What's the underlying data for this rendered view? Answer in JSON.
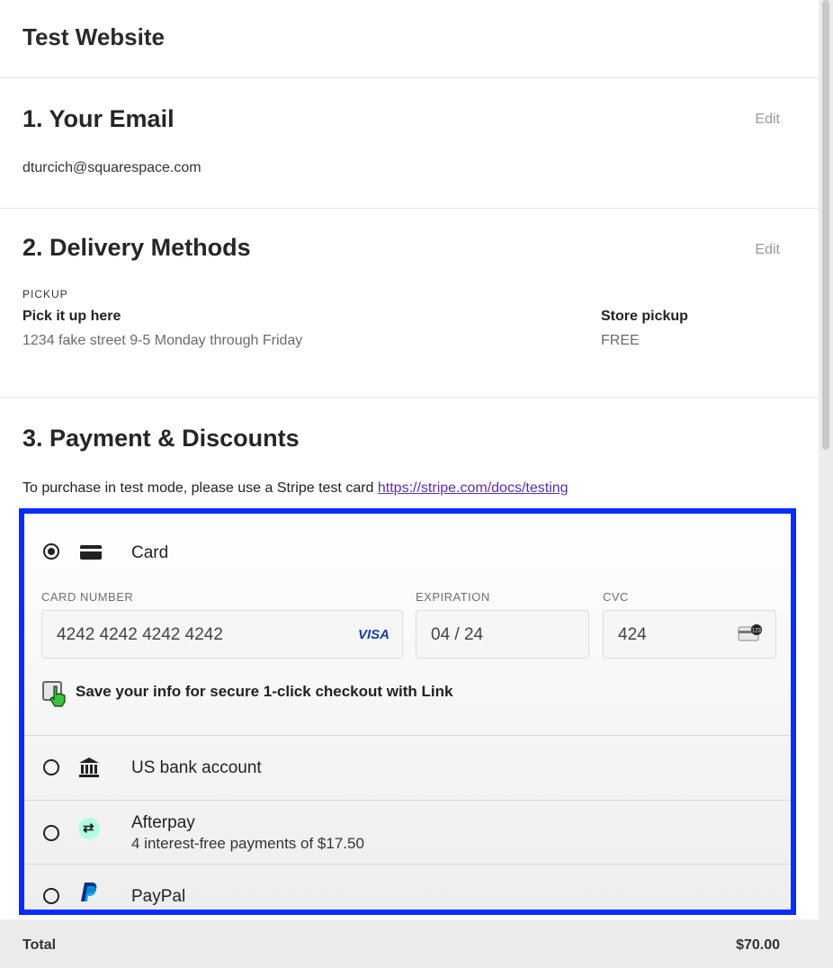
{
  "site": {
    "title": "Test Website"
  },
  "email_section": {
    "title": "1.  Your Email",
    "edit_label": "Edit",
    "email": "dturcich@squarespace.com"
  },
  "delivery_section": {
    "title": "2.  Delivery Methods",
    "edit_label": "Edit",
    "tag": "PICKUP",
    "location_name": "Pick it up here",
    "location_address": "1234 fake street 9-5 Monday through Friday",
    "method_name": "Store pickup",
    "method_price": "FREE"
  },
  "payment_section": {
    "title": "3.  Payment & Discounts",
    "test_note": "To purchase in test mode, please use a Stripe test card ",
    "test_link": "https://stripe.com/docs/testing",
    "card": {
      "label": "Card",
      "selected": true,
      "card_number_label": "CARD NUMBER",
      "card_number_value": "4242 4242 4242 4242",
      "card_brand": "VISA",
      "expiration_label": "EXPIRATION",
      "expiration_value": "04 / 24",
      "cvc_label": "CVC",
      "cvc_value": "424",
      "save_info_label": "Save your info for secure 1-click checkout with Link"
    },
    "options": [
      {
        "label": "US bank account",
        "icon": "bank-icon"
      },
      {
        "label": "Afterpay",
        "sublabel": "4 interest-free payments of $17.50",
        "icon": "afterpay-icon"
      },
      {
        "label": "PayPal",
        "icon": "paypal-icon"
      }
    ],
    "highlight_color": "#0a2dff"
  },
  "footer": {
    "total_label": "Total",
    "total_value": "$70.00"
  }
}
